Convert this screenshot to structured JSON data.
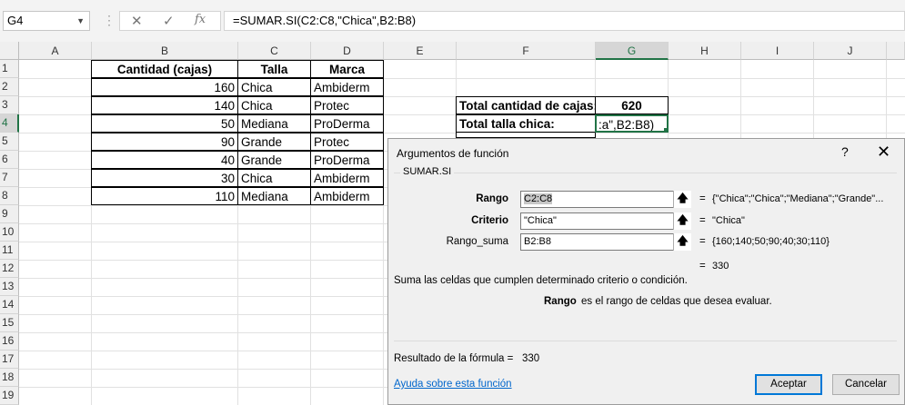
{
  "formula_bar": {
    "name_box": "G4",
    "cancel_icon": "✕",
    "enter_icon": "✓",
    "fx_icon": "fx",
    "formula": "=SUMAR.SI(C2:C8,\"Chica\",B2:B8)"
  },
  "columns": [
    "A",
    "B",
    "C",
    "D",
    "E",
    "F",
    "G",
    "H",
    "I",
    "J"
  ],
  "rows": [
    "1",
    "2",
    "3",
    "4",
    "5",
    "6",
    "7",
    "8",
    "9",
    "10",
    "11",
    "12",
    "13",
    "14",
    "15",
    "16",
    "17",
    "18",
    "19"
  ],
  "table": {
    "headers": [
      "Cantidad (cajas)",
      "Talla",
      "Marca"
    ],
    "rows": [
      [
        "160",
        "Chica",
        "Ambiderm"
      ],
      [
        "140",
        "Chica",
        "Protec"
      ],
      [
        "50",
        "Mediana",
        "ProDerma"
      ],
      [
        "90",
        "Grande",
        "Protec"
      ],
      [
        "40",
        "Grande",
        "ProDerma"
      ],
      [
        "30",
        "Chica",
        "Ambiderm"
      ],
      [
        "110",
        "Mediana",
        "Ambiderm"
      ]
    ]
  },
  "summary": {
    "total_cajas_label": "Total cantidad de cajas:",
    "total_cajas_value": "620",
    "total_chica_label": "Total talla chica:",
    "editing_text": ":a\",B2:B8)"
  },
  "dialog": {
    "title": "Argumentos de función",
    "help": "?",
    "close": "✕",
    "function_name": "SUMAR.SI",
    "args": [
      {
        "label": "Rango",
        "value": "C2:C8",
        "result": "{\"Chica\";\"Chica\";\"Mediana\";\"Grande\"..."
      },
      {
        "label": "Criterio",
        "value": "\"Chica\"",
        "result": "\"Chica\""
      },
      {
        "label": "Rango_suma",
        "value": "B2:B8",
        "result": "{160;140;50;90;40;30;110}"
      }
    ],
    "equals": "=",
    "total_result": "330",
    "description": "Suma las celdas que cumplen determinado criterio o condición.",
    "hint_arg": "Rango",
    "hint_text": "es el rango de celdas que desea evaluar.",
    "formula_result_label": "Resultado de la fórmula =",
    "formula_result_value": "330",
    "help_link": "Ayuda sobre esta función",
    "ok_label": "Aceptar",
    "cancel_label": "Cancelar"
  }
}
